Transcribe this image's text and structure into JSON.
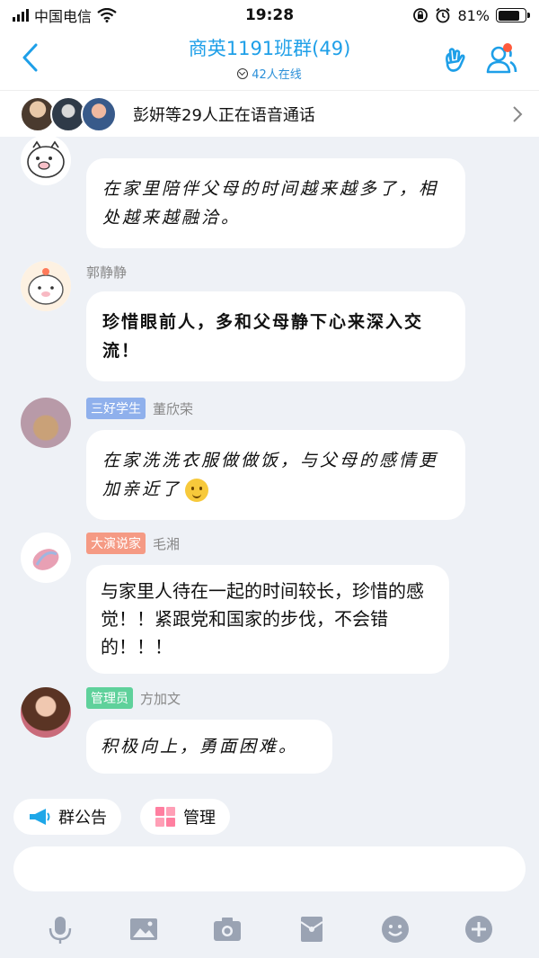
{
  "status_bar": {
    "carrier": "中国电信",
    "time": "19:28",
    "battery": "81%",
    "battery_level": 0.81
  },
  "header": {
    "title": "商英1191班群(49)",
    "online": "42人在线",
    "colors": {
      "title": "#1e9fe8",
      "badge": "#ff5a3c"
    }
  },
  "voice_call": {
    "text": "彭妍等29人正在语音通话"
  },
  "messages": [
    {
      "sender": "",
      "tag": "",
      "text": "在家里陪伴父母的时间越来越多了，相处越来越融洽。",
      "style": "script"
    },
    {
      "sender": "郭静静",
      "tag": "",
      "text": "珍惜眼前人，多和父母静下心来深入交流！",
      "style": "bold"
    },
    {
      "sender": "董欣荣",
      "tag": "三好学生",
      "tag_color": "#8fb0ec",
      "text": "在家洗洗衣服做做饭，与父母的感情更加亲近了",
      "emoji": "smile-emoji",
      "style": "script"
    },
    {
      "sender": "毛湘",
      "tag": "大演说家",
      "tag_color": "#f59a84",
      "text": "与家里人待在一起的时间较长，珍惜的感觉！！紧跟党和国家的步伐，不会错的！！！",
      "style": "normal"
    },
    {
      "sender": "方加文",
      "tag": "管理员",
      "tag_color": "#5fd19b",
      "text": "积极向上，勇面困难。",
      "style": "script"
    }
  ],
  "quick_actions": {
    "announcement": "群公告",
    "manage": "管理"
  },
  "toolbar": {
    "icons": [
      "microphone-icon",
      "image-icon",
      "camera-icon",
      "red-packet-icon",
      "emoji-icon",
      "plus-icon"
    ]
  }
}
